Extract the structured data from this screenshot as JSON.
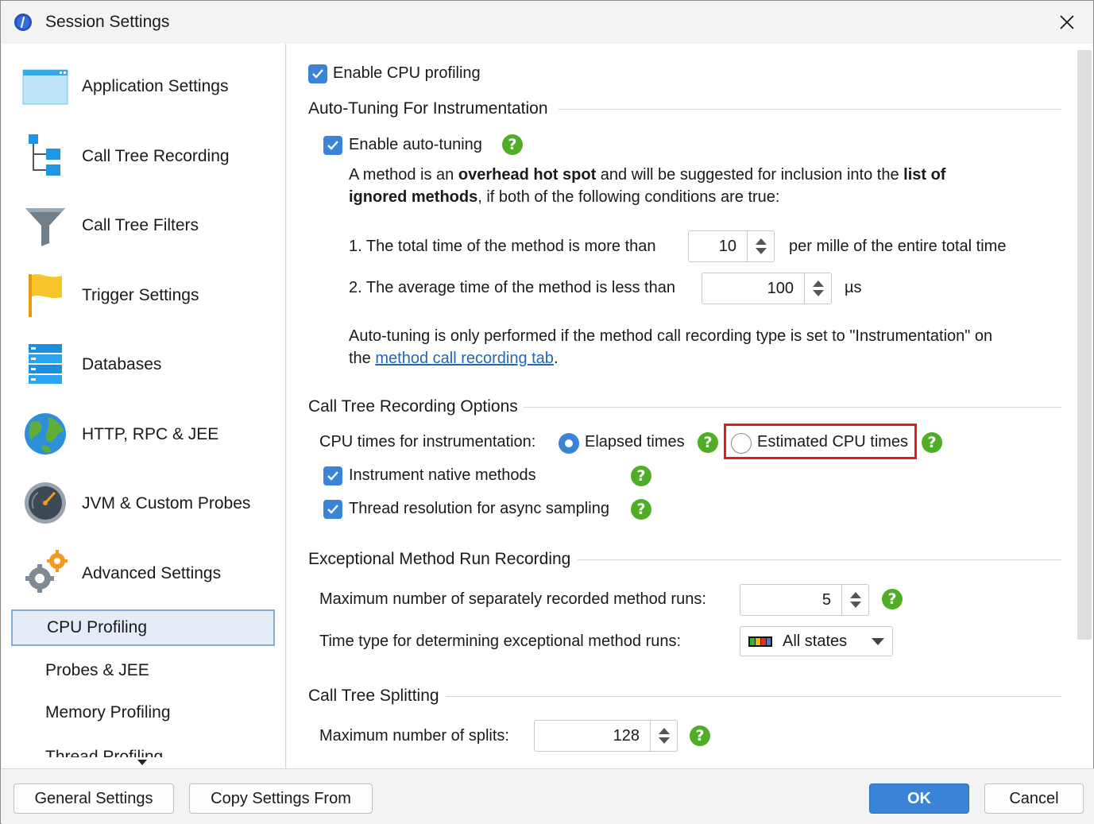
{
  "window": {
    "title": "Session Settings",
    "app_icon": "jprofiler-icon",
    "close_icon": "close-icon"
  },
  "sidebar": {
    "items": [
      {
        "label": "Application Settings",
        "icon": "application-window-icon"
      },
      {
        "label": "Call Tree Recording",
        "icon": "call-tree-icon"
      },
      {
        "label": "Call Tree Filters",
        "icon": "funnel-icon"
      },
      {
        "label": "Trigger Settings",
        "icon": "flag-icon"
      },
      {
        "label": "Databases",
        "icon": "database-icon"
      },
      {
        "label": "HTTP, RPC & JEE",
        "icon": "globe-icon"
      },
      {
        "label": "JVM & Custom Probes",
        "icon": "gauge-icon"
      },
      {
        "label": "Advanced Settings",
        "icon": "gears-icon"
      }
    ],
    "subitems": [
      {
        "label": "CPU Profiling",
        "selected": true
      },
      {
        "label": "Probes & JEE",
        "selected": false
      },
      {
        "label": "Memory Profiling",
        "selected": false
      },
      {
        "label": "Thread Profiling",
        "selected": false
      }
    ]
  },
  "content": {
    "enable_cpu_profiling": {
      "label": "Enable CPU profiling",
      "checked": true
    },
    "auto_tuning": {
      "title": "Auto-Tuning For Instrumentation",
      "enable": {
        "label": "Enable auto-tuning",
        "checked": true
      },
      "desc_1": "A method is an ",
      "desc_bold_1": "overhead hot spot",
      "desc_2": " and will be suggested for inclusion into the ",
      "desc_bold_2": "list of",
      "desc_bold_3": "ignored methods",
      "desc_3": ", if both of the following conditions are true:",
      "cond1_label": "1. The total time of the method is more than",
      "cond1_value": "10",
      "cond1_suffix": "per mille of the entire total time",
      "cond2_label": "2. The average time of the method is less than",
      "cond2_value": "100",
      "cond2_suffix": "µs",
      "note_1": "Auto-tuning is only performed if the method call recording type is set to \"Instrumentation\" on",
      "note_2": "the ",
      "note_link": "method call recording tab",
      "note_3": "."
    },
    "call_tree_options": {
      "title": "Call Tree Recording Options",
      "cpu_times_label": "CPU times for instrumentation:",
      "elapsed": {
        "label": "Elapsed times",
        "selected": true
      },
      "estimated": {
        "label": "Estimated CPU times",
        "selected": false
      },
      "instrument_native": {
        "label": "Instrument native methods",
        "checked": true
      },
      "thread_resolution": {
        "label": "Thread resolution for async sampling",
        "checked": true
      }
    },
    "exceptional": {
      "title": "Exceptional Method Run Recording",
      "max_runs_label": "Maximum number of separately recorded method runs:",
      "max_runs_value": "5",
      "time_type_label": "Time type for determining exceptional method runs:",
      "time_type_value": "All states",
      "time_type_icon": "thread-states-icon"
    },
    "splitting": {
      "title": "Call Tree Splitting",
      "max_splits_label": "Maximum number of splits:",
      "max_splits_value": "128"
    },
    "help_icon": "?"
  },
  "footer": {
    "general_settings": "General Settings",
    "copy_settings": "Copy Settings From",
    "ok": "OK",
    "cancel": "Cancel"
  },
  "colors": {
    "accent": "#3a83d6",
    "help": "#4fae25",
    "highlight": "#e31b1b",
    "selection": "#e4ecf7"
  }
}
